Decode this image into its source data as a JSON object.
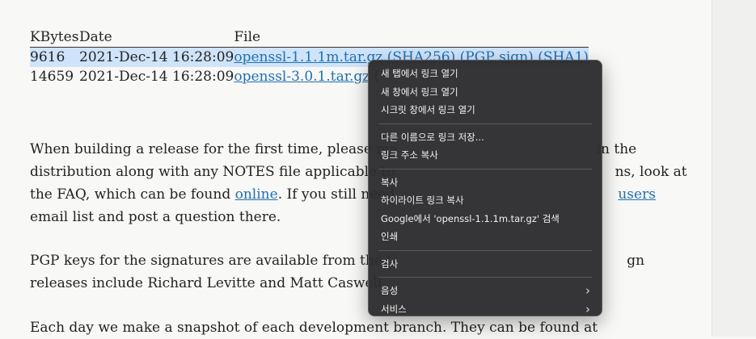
{
  "table": {
    "headers": [
      "KBytes",
      "Date",
      "File"
    ],
    "rows": [
      {
        "kbytes": "9616",
        "date": "2021-Dec-14 16:28:09",
        "file": "openssl-1.1.1m.tar.gz",
        "extra1": "(SHA256)",
        "extra2": "(PGP sign)",
        "extra3": "(SHA1)"
      },
      {
        "kbytes": "14659",
        "date": "2021-Dec-14 16:28:09",
        "file": "openssl-3.0.1.tar.gz",
        "extra1": "("
      }
    ]
  },
  "para1": {
    "l1a": "When building a release for the first time, please ma",
    "l1b": "in the",
    "l2a": "distribution along with any NOTES file applicable to",
    "l2b": "ns, look at",
    "l3a": "the FAQ, which can be found ",
    "l3link": "online",
    "l3b": ". If you still need",
    "l3link2": "users",
    "l4": "email list and post a question there."
  },
  "para2": {
    "l1a": "PGP keys for the signatures are available from the ",
    "l1link": "O",
    "l1b": "gn",
    "l2": "releases include Richard Levitte and Matt Caswell."
  },
  "para3": {
    "l1": "Each day we make a snapshot of each development branch. They can be found at"
  },
  "context_menu": {
    "items": [
      "새 탭에서 링크 열기",
      "새 창에서 링크 열기",
      "시크릿 창에서 링크 열기",
      "다른 이름으로 링크 저장...",
      "링크 주소 복사",
      "복사",
      "하이라이트 링크 복사",
      "Google에서 'openssl-1.1.1m.tar.gz' 검색",
      "인쇄",
      "검사",
      "음성",
      "서비스"
    ],
    "submenu_chevron": "›"
  }
}
